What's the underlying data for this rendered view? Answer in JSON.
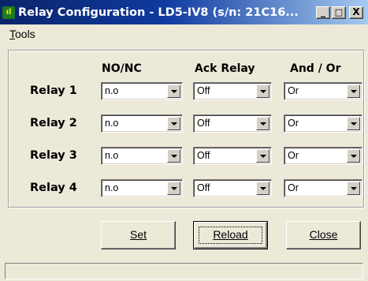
{
  "window": {
    "title": "Relay Configuration - LD5-IV8 (s/n: 21C16...",
    "icon_name": "app-icon",
    "title_bg": "#0a246a",
    "minimize_glyph": "_",
    "maximize_glyph": "□",
    "close_glyph": "X"
  },
  "menu": {
    "tools_mnemonic": "T",
    "tools_rest": "ools"
  },
  "columns": {
    "nonc": "NO/NC",
    "ack": "Ack Relay",
    "andor": "And / Or"
  },
  "relays": [
    {
      "label": "Relay 1",
      "nonc": "n.o",
      "ack": "Off",
      "andor": "Or"
    },
    {
      "label": "Relay 2",
      "nonc": "n.o",
      "ack": "Off",
      "andor": "Or"
    },
    {
      "label": "Relay 3",
      "nonc": "n.o",
      "ack": "Off",
      "andor": "Or"
    },
    {
      "label": "Relay 4",
      "nonc": "n.o",
      "ack": "Off",
      "andor": "Or"
    }
  ],
  "buttons": {
    "set": "Set",
    "reload": "Reload",
    "close": "Close"
  },
  "status": {
    "text": ""
  }
}
